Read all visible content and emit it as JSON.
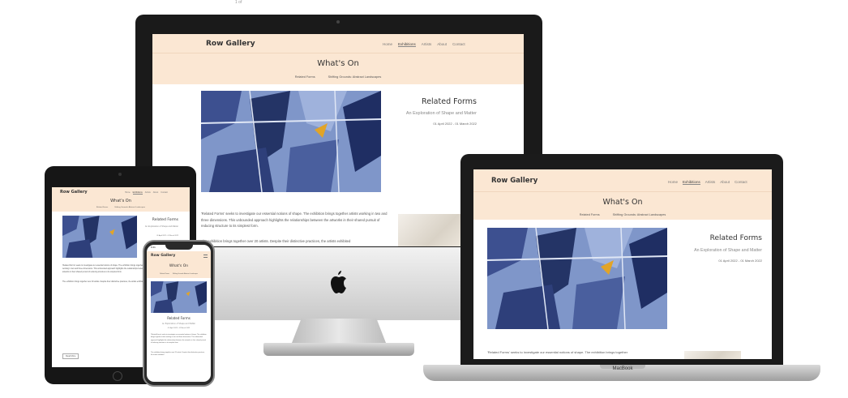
{
  "top_label": "1 of",
  "site": {
    "brand": "Row Gallery",
    "nav": [
      "Home",
      "Exhibitions",
      "Artists",
      "About",
      "Contact"
    ],
    "heading": "What's On",
    "sub_links": [
      "Related Forms",
      "Shifting Grounds: Abstract Landscapes"
    ],
    "exhibition_title": "Related Forms",
    "exhibition_subtitle": "An Exploration of Shape and Matter",
    "exhibition_dates": "01 April 2022 - 01 March 2022",
    "body_p1": "'Related Forms' seeks to investigate our essential notions of shape. The exhibition brings together artists working in two and three dimensions. This unbounded approach highlights the relationships between the artworks in their shared pursuit of reducing structure to its simplest form.",
    "body_p2": "The exhibition brings together over 20 artists. Despite their distinctive practices, the artists exhibited",
    "laptop_body": "'Related Forms' seeks to investigate our essential notions of shape. The exhibition brings together",
    "read_more": "Read More",
    "phone_time": "9:41"
  },
  "laptop_model": "MacBook",
  "colors": {
    "header_bg": "#fbe7d3",
    "artwork_blue": "#6f86bd",
    "artwork_navy": "#1f2e63",
    "artwork_accent": "#e2a427"
  }
}
